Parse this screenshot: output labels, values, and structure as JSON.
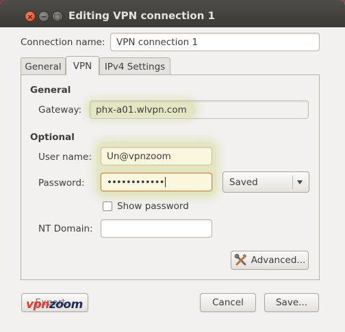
{
  "window": {
    "title": "Editing VPN connection 1",
    "close_glyph": "×",
    "minimize_glyph": "−",
    "maximize_glyph": "□"
  },
  "connection_name": {
    "label": "Connection name:",
    "value": "VPN connection 1"
  },
  "tabs": [
    {
      "label": "General",
      "active": false
    },
    {
      "label": "VPN",
      "active": true
    },
    {
      "label": "IPv4 Settings",
      "active": false
    }
  ],
  "vpn": {
    "general_heading": "General",
    "gateway_label": "Gateway:",
    "gateway_value": "phx-a01.wlvpn.com",
    "optional_heading": "Optional",
    "username_label": "User name:",
    "username_value": "Un@vpnzoom",
    "password_label": "Password:",
    "password_value": "••••••••••••",
    "password_storage": "Saved",
    "show_password_label": "Show password",
    "show_password_checked": false,
    "nt_domain_label": "NT Domain:",
    "nt_domain_value": "",
    "advanced_button": "Advanced..."
  },
  "footer": {
    "export_button": "Export...",
    "cancel_button": "Cancel",
    "save_button": "Save..."
  },
  "watermark": {
    "part1": "vpn",
    "part2": "zoom"
  },
  "colors": {
    "title_bar": "#3f3e3a",
    "highlight": "#d2d78c",
    "watermark_red": "#e8352a",
    "watermark_navy": "#1f2a5c"
  },
  "icons": {
    "advanced_button_icon": "tools-icon",
    "combo_arrow": "chevron-down-icon"
  }
}
